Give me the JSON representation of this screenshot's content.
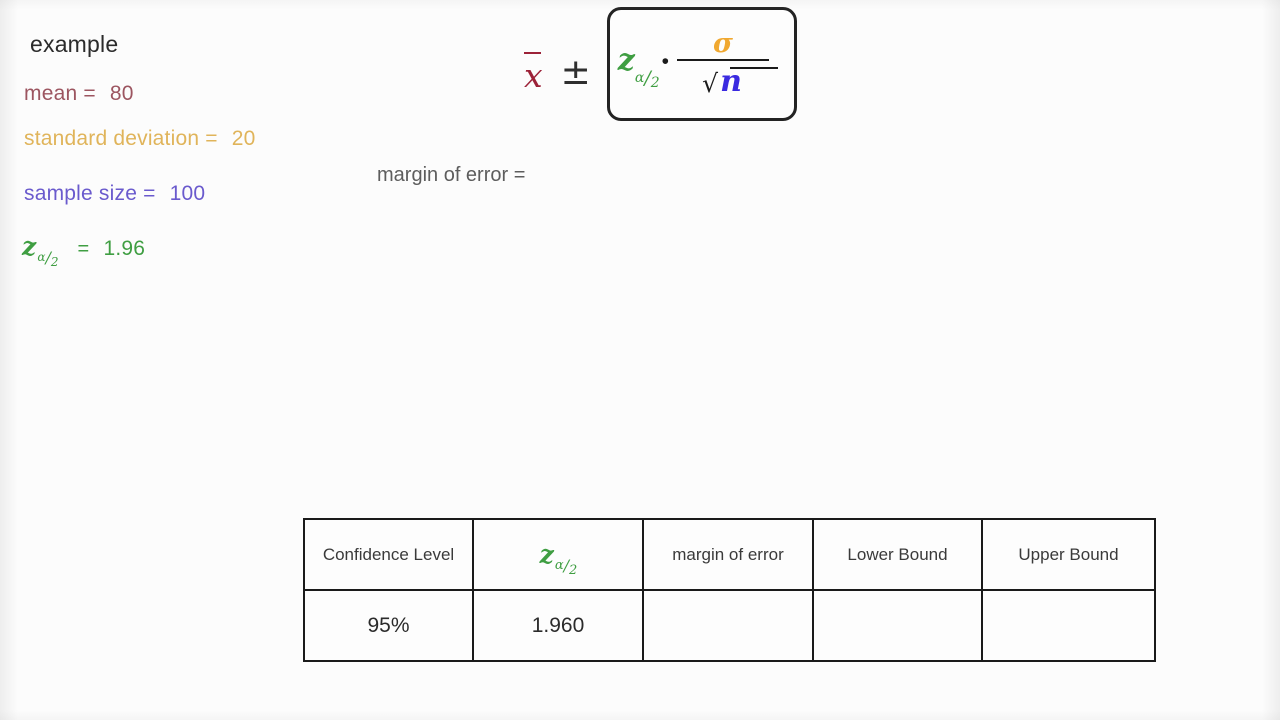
{
  "page": {
    "heading": "example",
    "background_color": "#fcfcfc"
  },
  "parameters": [
    {
      "label": "mean =",
      "value": "80",
      "color": "#9c5560"
    },
    {
      "label": "standard deviation =",
      "value": "20",
      "color": "#e0b45a"
    },
    {
      "label": "sample size =",
      "value": "100",
      "color": "#6a5acd"
    },
    {
      "label": "z_alpha/2 =",
      "value": "1.96",
      "color": "#3f9e42"
    }
  ],
  "z_symbol": {
    "base": "z",
    "sub_alpha": "α",
    "sub_slash": "/",
    "sub_two": "2"
  },
  "formula": {
    "mean_symbol": "x",
    "plus_minus": "±",
    "z_base": "z",
    "multiply_dot": "•",
    "numerator": "σ",
    "radical": "√",
    "radicand": "n",
    "colors": {
      "mean": "#9c2238",
      "z": "#3f9e42",
      "sigma": "#f0a830",
      "n": "#3a2ae0",
      "box_border": "#232323"
    }
  },
  "margin_of_error": {
    "label": "margin of error =",
    "value": ""
  },
  "table": {
    "headers": [
      "Confidence Level",
      "z_alpha/2",
      "margin of error",
      "Lower Bound",
      "Upper Bound"
    ],
    "rows": [
      {
        "confidence_level": "95%",
        "z_score": "1.960",
        "margin_of_error": "",
        "lower_bound": "",
        "upper_bound": ""
      }
    ]
  }
}
